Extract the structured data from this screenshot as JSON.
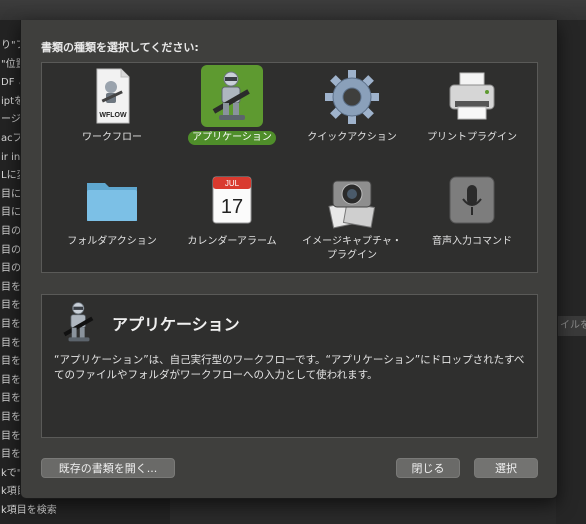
{
  "background": {
    "sidebar_rows": [
      "り\"フ",
      "\"位置",
      "DF と",
      "iptを",
      "ージ",
      "acプレ",
      "ir in K",
      "Lに変",
      "目に\"",
      "目に\"",
      "目のS",
      "目の名",
      "目の名",
      "目を\"",
      "目を\"",
      "目を結",
      "目を開",
      "目を検",
      "目を表",
      "目を移",
      "目を参",
      "目を結",
      "目を表",
      "kで\"",
      "k項目",
      "k項目を検索"
    ],
    "right_button_text": "イルを"
  },
  "dialog": {
    "prompt": "書類の種類を選択してください:",
    "types": [
      {
        "label": "ワークフロー",
        "icon": "workflow-document-icon",
        "selected": false
      },
      {
        "label": "アプリケーション",
        "icon": "automator-robot-icon",
        "selected": true
      },
      {
        "label": "クイックアクション",
        "icon": "gear-icon",
        "selected": false
      },
      {
        "label": "プリントプラグイン",
        "icon": "printer-icon",
        "selected": false
      },
      {
        "label": "フォルダアクション",
        "icon": "folder-icon",
        "selected": false
      },
      {
        "label": "カレンダーアラーム",
        "icon": "calendar-icon",
        "selected": false
      },
      {
        "label": "イメージキャプチャ・プラグイン",
        "icon": "camera-icon",
        "selected": false
      },
      {
        "label": "音声入力コマンド",
        "icon": "microphone-icon",
        "selected": false
      }
    ],
    "workflow_badge": "WFLOW",
    "calendar_month": "JUL",
    "calendar_day": "17",
    "selected_title": "アプリケーション",
    "selected_description": "“アプリケーション”は、自己実行型のワークフローです。“アプリケーション”にドロップされたすべてのファイルやフォルダがワークフローへの入力として使われます。",
    "buttons": {
      "open_existing": "既存の書類を開く...",
      "close": "閉じる",
      "choose": "選択"
    }
  },
  "colors": {
    "selection_green": "#5e9a30",
    "sheet_bg": "#3f3f3d",
    "panel_bg": "#2f2f2e"
  }
}
